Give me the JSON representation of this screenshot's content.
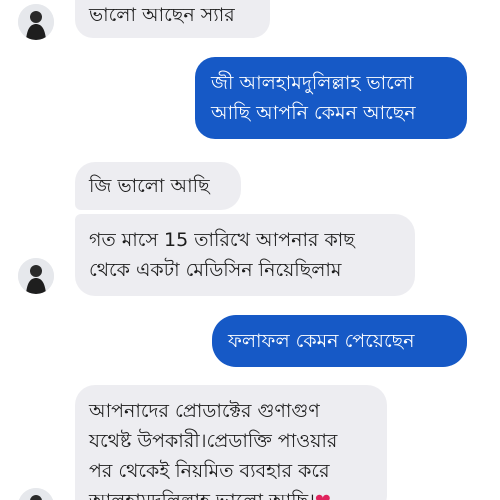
{
  "messages": [
    {
      "direction": "incoming",
      "lines": [
        "ভালো আছেন স্যার"
      ]
    },
    {
      "direction": "outgoing",
      "lines": [
        "জী আলহামদুলিল্লাহ ভালো",
        "আছি আপনি কেমন আছেন"
      ]
    },
    {
      "direction": "incoming",
      "lines": [
        "জি ভালো আছি"
      ]
    },
    {
      "direction": "incoming",
      "lines": [
        "গত মাসে 15 তারিখে আপনার কাছ",
        "থেকে একটা মেডিসিন নিয়েছিলাম"
      ]
    },
    {
      "direction": "outgoing",
      "lines": [
        "ফলাফল কেমন পেয়েছেন"
      ]
    },
    {
      "direction": "incoming",
      "lines": [
        "আপনাদের প্রোডাক্টের গুণাগুণ",
        "যথেষ্ট উপকারী।প্রেডাক্তি পাওয়ার",
        "পর থেকেই নিয়মিত ব্যবহার করে",
        "আলহামদুলিল্লাহ ভালো আছি।"
      ],
      "emoji": "heart-emoji",
      "emoji_glyph": "❤"
    }
  ],
  "colors": {
    "incoming_bubble": "#ededf1",
    "outgoing_bubble": "#1659c6",
    "incoming_text": "#1c1c1c",
    "outgoing_text": "#ffffff",
    "heart": "#e0245e"
  },
  "icons": [
    "contact-avatar-icon"
  ]
}
